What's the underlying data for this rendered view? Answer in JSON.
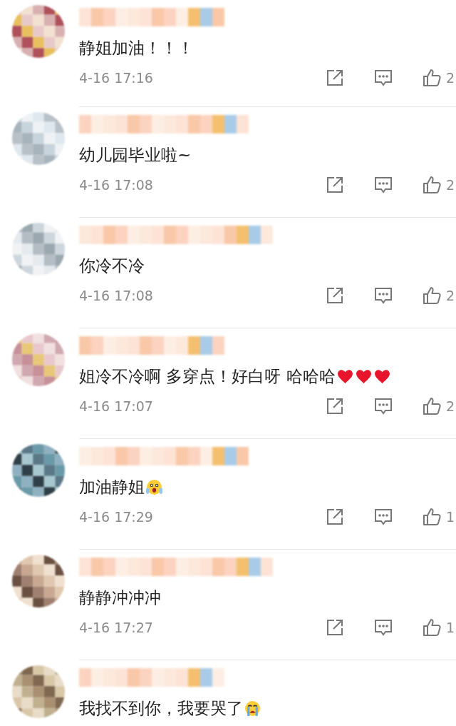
{
  "comments": [
    {
      "text": "静姐加油！！！",
      "time": "4-16 17:16",
      "likes": "2"
    },
    {
      "text": "幼儿园毕业啦~",
      "time": "4-16 17:08",
      "likes": "2"
    },
    {
      "text": "你冷不冷",
      "time": "4-16 17:08",
      "likes": "2"
    },
    {
      "text": "姐冷不冷啊 多穿点！好白呀 哈哈哈",
      "emoji": [
        {
          "kind": "heart"
        },
        {
          "kind": "heart"
        },
        {
          "kind": "heart"
        }
      ],
      "time": "4-16 17:07",
      "likes": "2"
    },
    {
      "text": "加油静姐",
      "emoji": [
        {
          "kind": "shocked"
        }
      ],
      "time": "4-16 17:29",
      "likes": "1"
    },
    {
      "text": "静静冲冲冲",
      "time": "4-16 17:27",
      "likes": "1"
    },
    {
      "text": "我找不到你，我要哭了",
      "emoji": [
        {
          "kind": "crying"
        }
      ]
    }
  ]
}
